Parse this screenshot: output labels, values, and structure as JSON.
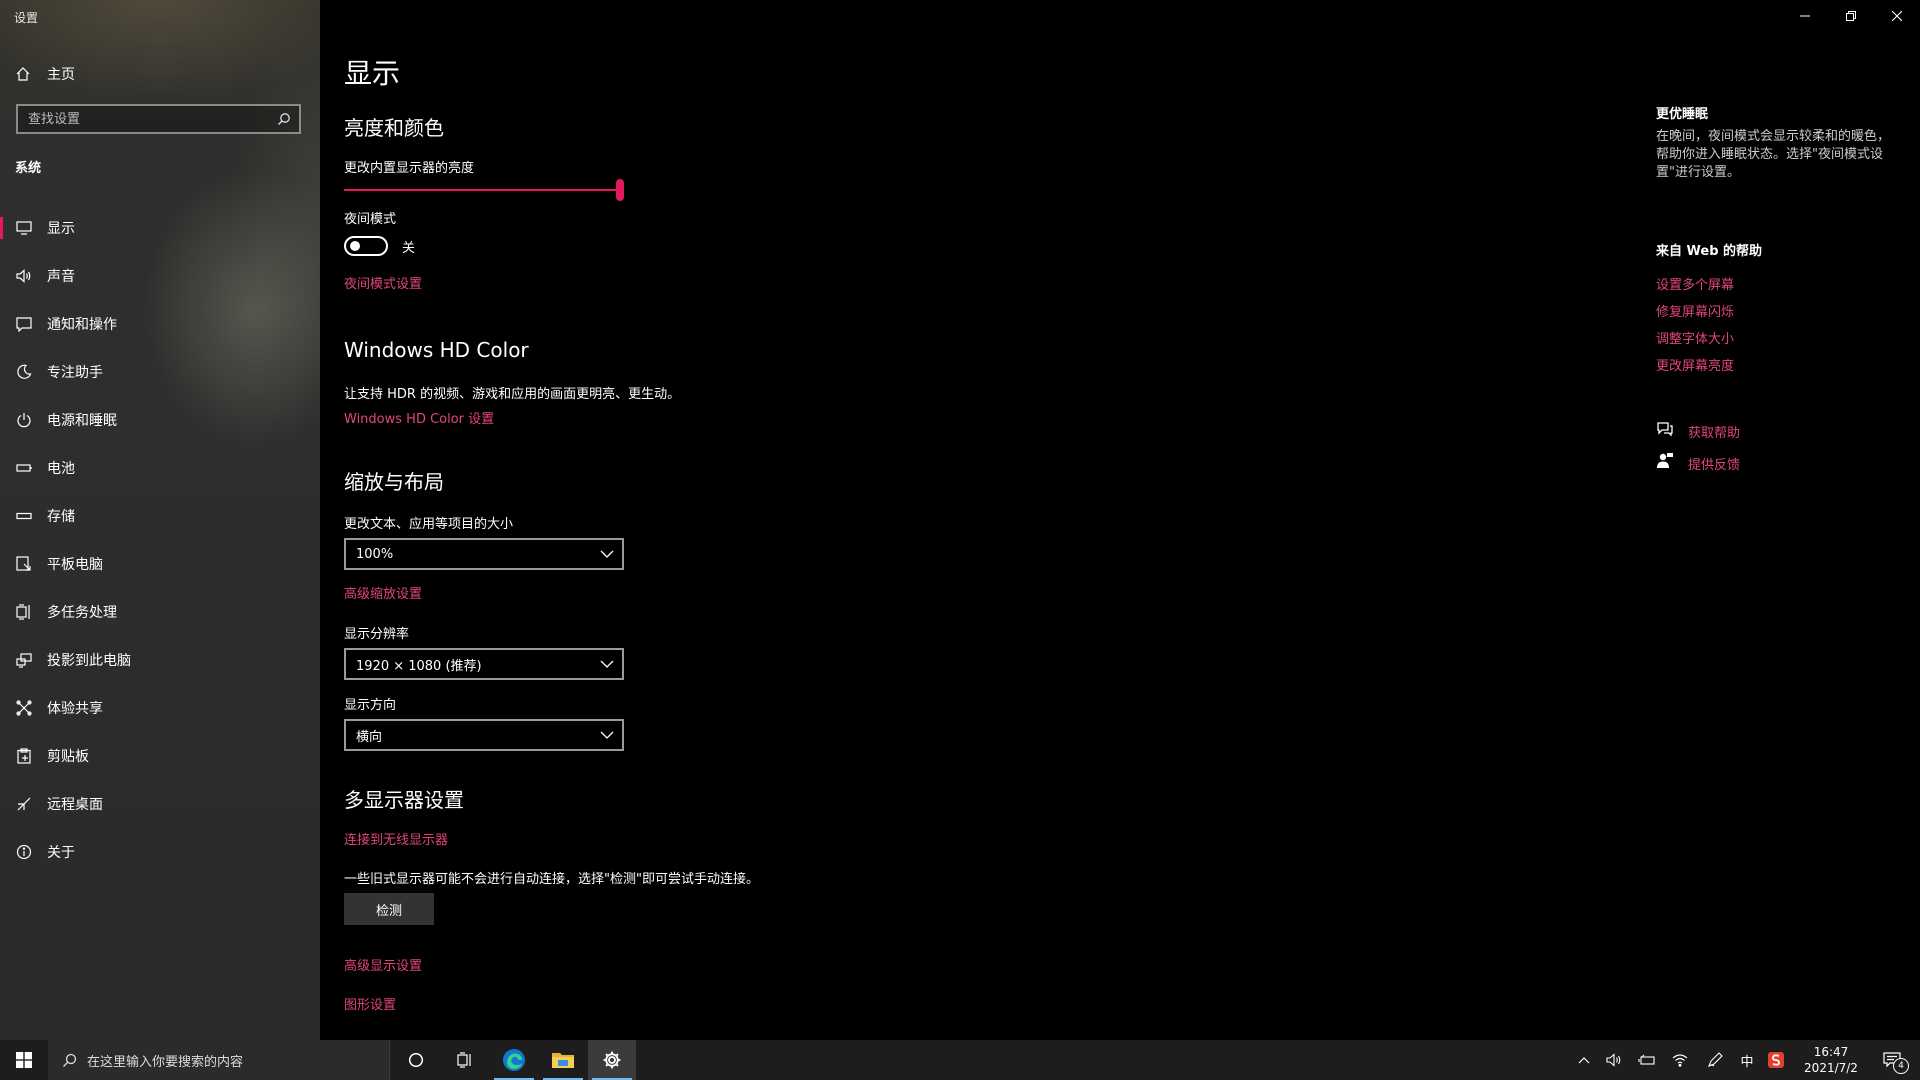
{
  "window": {
    "app_title": "设置"
  },
  "sidebar": {
    "home_label": "主页",
    "search_placeholder": "查找设置",
    "section": "系统",
    "items": [
      {
        "label": "显示",
        "icon": "monitor-icon",
        "active": true
      },
      {
        "label": "声音",
        "icon": "speaker-icon"
      },
      {
        "label": "通知和操作",
        "icon": "notification-icon"
      },
      {
        "label": "专注助手",
        "icon": "moon-icon"
      },
      {
        "label": "电源和睡眠",
        "icon": "power-icon"
      },
      {
        "label": "电池",
        "icon": "battery-icon"
      },
      {
        "label": "存储",
        "icon": "storage-icon"
      },
      {
        "label": "平板电脑",
        "icon": "tablet-icon"
      },
      {
        "label": "多任务处理",
        "icon": "multitask-icon"
      },
      {
        "label": "投影到此电脑",
        "icon": "project-icon"
      },
      {
        "label": "体验共享",
        "icon": "share-icon"
      },
      {
        "label": "剪贴板",
        "icon": "clipboard-icon"
      },
      {
        "label": "远程桌面",
        "icon": "remote-desktop-icon"
      },
      {
        "label": "关于",
        "icon": "info-icon"
      }
    ]
  },
  "main": {
    "title": "显示",
    "brightness": {
      "heading": "亮度和颜色",
      "label": "更改内置显示器的亮度",
      "value_percent": 100
    },
    "night_light": {
      "label": "夜间模式",
      "state": "关",
      "settings_link": "夜间模式设置"
    },
    "hdr": {
      "heading": "Windows HD Color",
      "description": "让支持 HDR 的视频、游戏和应用的画面更明亮、更生动。",
      "link": "Windows HD Color 设置"
    },
    "scale": {
      "heading": "缩放与布局",
      "size_label": "更改文本、应用等项目的大小",
      "size_value": "100%",
      "advanced_link": "高级缩放设置",
      "resolution_label": "显示分辨率",
      "resolution_value": "1920 × 1080 (推荐)",
      "orientation_label": "显示方向",
      "orientation_value": "横向"
    },
    "multi": {
      "heading": "多显示器设置",
      "wireless_link": "连接到无线显示器",
      "description": "一些旧式显示器可能不会进行自动连接，选择\"检测\"即可尝试手动连接。",
      "detect_button": "检测",
      "advanced_display_link": "高级显示设置",
      "graphics_link": "图形设置"
    }
  },
  "right_panel": {
    "sleep_heading": "更优睡眠",
    "sleep_text": "在晚间，夜间模式会显示较柔和的暖色，帮助你进入睡眠状态。选择\"夜间模式设置\"进行设置。",
    "web_help_heading": "来自 Web 的帮助",
    "web_links": [
      "设置多个屏幕",
      "修复屏幕闪烁",
      "调整字体大小",
      "更改屏幕亮度"
    ],
    "get_help": "获取帮助",
    "feedback": "提供反馈"
  },
  "taskbar": {
    "search_placeholder": "在这里输入你要搜索的内容",
    "ime": "中",
    "time": "16:47",
    "date": "2021/7/2",
    "notification_count": "4"
  },
  "colors": {
    "accent": "#e3195f",
    "link": "#e0457f",
    "background": "#000000",
    "sidebar": "#2d2e2d",
    "taskbar": "#1d1d1d"
  }
}
